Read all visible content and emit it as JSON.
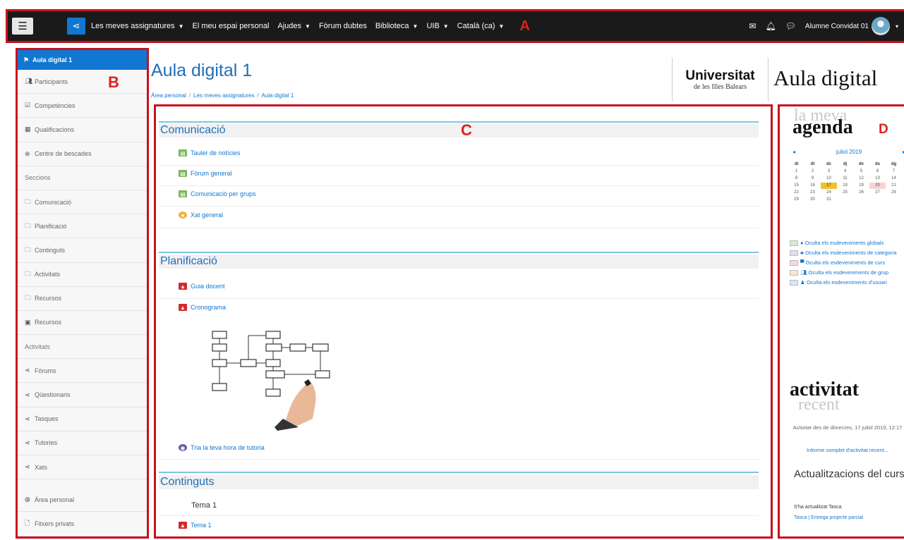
{
  "navbar": {
    "menu_items": [
      {
        "label": "Les meves assignatures",
        "has_caret": true
      },
      {
        "label": "El meu espai personal",
        "has_caret": false
      },
      {
        "label": "Ajudes",
        "has_caret": true
      },
      {
        "label": "Fòrum dubtes",
        "has_caret": false
      },
      {
        "label": "Biblioteca",
        "has_caret": true
      },
      {
        "label": "UIB",
        "has_caret": true
      },
      {
        "label": "Català (ca)",
        "has_caret": true
      }
    ],
    "user_name": "Alumne Convidat 01",
    "icons": [
      "menu-icon",
      "share-icon",
      "envelope-icon",
      "bell-icon",
      "chat-icon"
    ]
  },
  "region_labels": {
    "a": "A",
    "b": "B",
    "c": "C",
    "d": "D"
  },
  "sidebar": {
    "active": "Aula digital 1",
    "items": [
      {
        "label": "Participants",
        "icon": "users-icon",
        "type": "link"
      },
      {
        "label": "Competències",
        "icon": "checklist-icon",
        "type": "link"
      },
      {
        "label": "Qualificacions",
        "icon": "table-icon",
        "type": "link"
      },
      {
        "label": "Centre de bescades",
        "icon": "globe-icon",
        "type": "link"
      },
      {
        "label": "Seccions",
        "icon": "",
        "type": "heading"
      },
      {
        "label": "Comunicació",
        "icon": "folder-icon",
        "type": "link"
      },
      {
        "label": "Planificació",
        "icon": "folder-icon",
        "type": "link"
      },
      {
        "label": "Continguts",
        "icon": "folder-icon",
        "type": "link"
      },
      {
        "label": "Activitats",
        "icon": "folder-icon",
        "type": "link"
      },
      {
        "label": "Recursos",
        "icon": "folder-icon",
        "type": "link"
      },
      {
        "label": "Recursos",
        "icon": "archive-icon",
        "type": "link"
      },
      {
        "label": "Activitats",
        "icon": "",
        "type": "heading"
      },
      {
        "label": "Fòrums",
        "icon": "share-icon",
        "type": "link"
      },
      {
        "label": "Qüestionaris",
        "icon": "share-icon",
        "type": "link"
      },
      {
        "label": "Tasques",
        "icon": "share-icon",
        "type": "link"
      },
      {
        "label": "Tutories",
        "icon": "share-icon",
        "type": "link"
      },
      {
        "label": "Xats",
        "icon": "share-icon",
        "type": "link"
      },
      {
        "label": "Àrea personal",
        "icon": "dashboard-icon",
        "type": "link"
      },
      {
        "label": "Fitxers privats",
        "icon": "file-icon",
        "type": "link"
      }
    ]
  },
  "header": {
    "title": "Aula digital 1",
    "breadcrumb": [
      "Àrea personal",
      "Les meves assignatures",
      "Aula digital 1"
    ],
    "logo_line1": "Universitat",
    "logo_line2": "de les Illes Balears",
    "brand_text": "Aula digital"
  },
  "sections": {
    "comunicacio": {
      "title": "Comunicació",
      "activities": [
        "Tauler de notícies",
        "Fòrum general",
        "Comunicació per grups",
        "Xat general"
      ]
    },
    "planificacio": {
      "title": "Planificació",
      "activities": [
        "Guia docent",
        "Cronograma"
      ],
      "extra_activity": "Tria la teva hora de tutoria"
    },
    "continguts": {
      "title": "Continguts",
      "label": "Tema 1",
      "activities": [
        "Tema 1"
      ]
    }
  },
  "calendar": {
    "ghost_title": "la meva",
    "title": "agenda",
    "month": "juliol 2019",
    "prev": "◂",
    "next": "▸",
    "weekdays": [
      "dl",
      "dt",
      "dc",
      "dj",
      "dv",
      "ds",
      "dg"
    ],
    "weeks": [
      [
        "1",
        "2",
        "3",
        "4",
        "5",
        "6",
        "7"
      ],
      [
        "8",
        "9",
        "10",
        "11",
        "12",
        "13",
        "14"
      ],
      [
        "15",
        "16",
        "17",
        "18",
        "19",
        "20",
        "21"
      ],
      [
        "22",
        "23",
        "24",
        "25",
        "26",
        "27",
        "28"
      ],
      [
        "29",
        "30",
        "31",
        "",
        "",
        "",
        ""
      ]
    ],
    "today": "17",
    "event_day": "20",
    "legend": [
      {
        "label": "Oculta els esdeveniments globals",
        "color": "#d4ecd4",
        "icon": "globe-icon"
      },
      {
        "label": "Oculta els esdeveniments de categoria",
        "color": "#e3dcf2",
        "icon": "sitemap-icon"
      },
      {
        "label": "Oculta els esdeveniments de curs",
        "color": "#f4dada",
        "icon": "university-icon"
      },
      {
        "label": "Oculta els esdeveniments de grup",
        "color": "#fbe7cf",
        "icon": "group-icon"
      },
      {
        "label": "Oculta els esdeveniments d'usuari",
        "color": "#dce8f7",
        "icon": "user-icon"
      }
    ]
  },
  "recent": {
    "title": "activitat",
    "ghost_title": "recent",
    "since": "Activitat des de dimecres, 17 juliol 2019, 12:17",
    "full_report": "Informe complet d'activitat recent...",
    "updates_title": "Actualitzacions del curs:",
    "update_text": "S'ha actualitzat Tasca",
    "update_link": "Tasca | Entrega projecte parcial"
  },
  "colors": {
    "accent": "#1177d1",
    "outline": "#c8101c",
    "section_rule": "#7dc6dc"
  }
}
